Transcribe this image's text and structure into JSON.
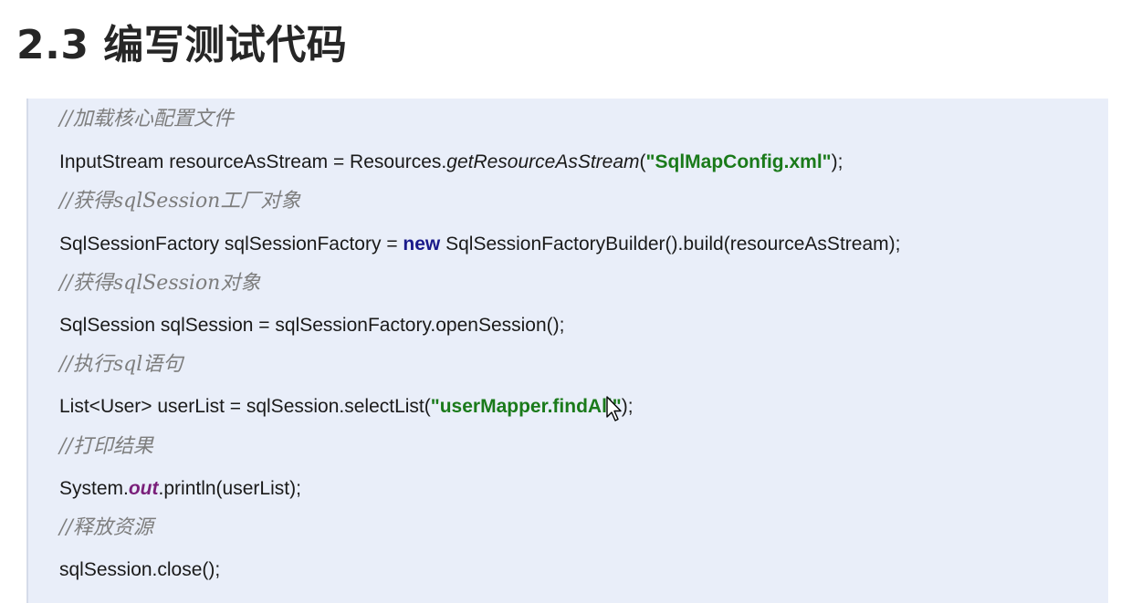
{
  "title": "2.3 编写测试代码",
  "code": {
    "c1": "//加载核心配置文件",
    "l1_a": "InputStream resourceAsStream = Resources.",
    "l1_b": "getResourceAsStream",
    "l1_c": "(",
    "l1_str": "\"SqlMapConfig.xml\"",
    "l1_d": ");",
    "c2": "//获得sqlSession工厂对象",
    "l2_a": "SqlSessionFactory sqlSessionFactory = ",
    "l2_kw": "new",
    "l2_b": " SqlSessionFactoryBuilder().build(resourceAsStream);",
    "c3": "//获得sqlSession对象",
    "l3": "SqlSession sqlSession = sqlSessionFactory.openSession();",
    "c4": "//执行sql语句",
    "l4_a": "List<User> userList = sqlSession.selectList(",
    "l4_str": "\"userMapper.findAll\"",
    "l4_b": ");",
    "c5": "//打印结果",
    "l5_a": "System.",
    "l5_field": "out",
    "l5_b": ".println(userList);",
    "c6": "//释放资源",
    "l6": "sqlSession.close();"
  },
  "icons": {
    "cursor": "mouse-pointer-icon"
  },
  "colors": {
    "code_bg": "#e9eef9",
    "comment": "#7d7d7d",
    "string": "#1a7a1a",
    "keyword": "#1a1a8a",
    "static_field": "#7a1f7a"
  }
}
